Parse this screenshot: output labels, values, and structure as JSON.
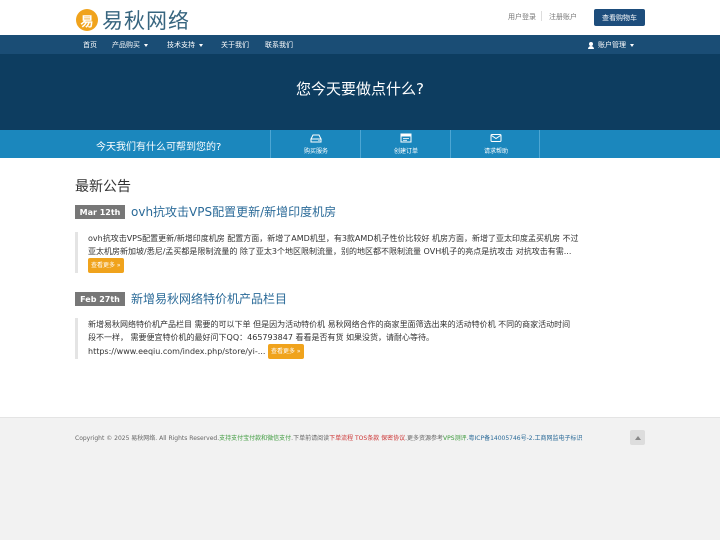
{
  "header": {
    "logo_glyph": "易",
    "logo_text": "易秋网络",
    "login_label": "用户登录",
    "register_label": "注册账户",
    "cart_label": "查看购物车"
  },
  "nav": {
    "items": [
      {
        "label": "首页"
      },
      {
        "label": "产品购买"
      },
      {
        "label": "技术支持"
      },
      {
        "label": "关于我们"
      },
      {
        "label": "联系我们"
      }
    ],
    "account_label": "账户管理"
  },
  "hero": {
    "title": "您今天要做点什么?"
  },
  "actions": {
    "prompt": "今天我们有什么可帮到您的?",
    "tiles": [
      {
        "label": "购买服务",
        "icon": "server-icon"
      },
      {
        "label": "创建订单",
        "icon": "invoice-icon"
      },
      {
        "label": "请求帮助",
        "icon": "envelope-icon"
      }
    ]
  },
  "announcements": {
    "title": "最新公告",
    "items": [
      {
        "date": "Mar 12th",
        "title": "ovh抗攻击VPS配置更新/新增印度机房",
        "line1": "ovh抗攻击VPS配置更新/新增印度机房 配置方面，新增了AMD机型，有3款AMD机子性价比较好 机房方面，新增了亚太印度孟买机房 不过",
        "line2": "亚太机房新加坡/悉尼/孟买都是限制流量的 除了亚太3个地区限制流量，别的地区都不限制流量 OVH机子的亮点是抗攻击 对抗攻击有需...",
        "more": "查看更多 »"
      },
      {
        "date": "Feb 27th",
        "title": "新增易秋网络特价机产品栏目",
        "line1": "新增易秋网络特价机产品栏目 需要的可以下单 但是因为活动特价机 易秋网络合作的商家里面筛选出来的活动特价机 不同的商家活动时间",
        "line2": "段不一样， 需要便宜特价机的最好问下QQ：465793847 看看是否有货 如果没货，请耐心等待。",
        "line3": "https://www.eeqiu.com/index.php/store/yi-...",
        "more": "查看更多 »"
      }
    ]
  },
  "footer": {
    "copyright": "Copyright © 2025 易秋网络. All Rights Reserved.",
    "pay": "支持支付宝付款和微信支付",
    "note": ".下单前请阅读",
    "flow": "下单流程",
    "tos": " TOS条款",
    "privacy": " 保密协议",
    "more_ref": ".更多资源参考",
    "vps": "VPS测评",
    "icp": ".粤ICP备14005746号-2.工商网监电子标识"
  }
}
